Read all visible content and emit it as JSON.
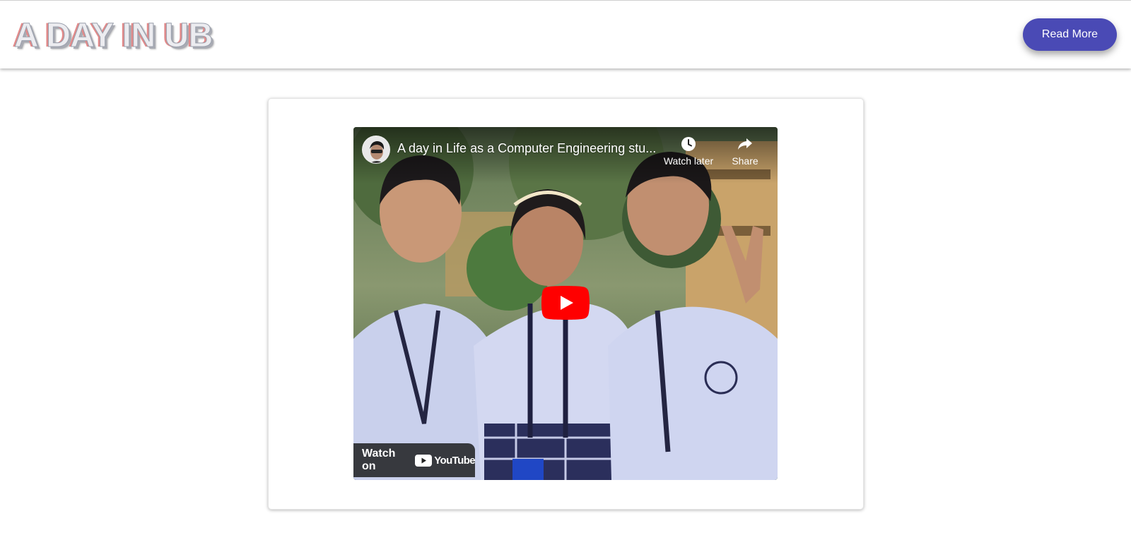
{
  "header": {
    "site_title": "A DAY IN UB",
    "read_more_label": "Read More"
  },
  "video": {
    "title": "A day in Life as a Computer Engineering stu...",
    "watch_later_label": "Watch later",
    "share_label": "Share",
    "watch_on_label": "Watch on",
    "youtube_logo_text": "YouTube",
    "icons": [
      "channel-avatar",
      "clock-icon",
      "share-arrow-icon",
      "play-icon",
      "youtube-logo"
    ]
  },
  "colors": {
    "button_bg": "#4a4ab5",
    "play_red": "#ff0000",
    "title_fill": "#ececf0"
  }
}
